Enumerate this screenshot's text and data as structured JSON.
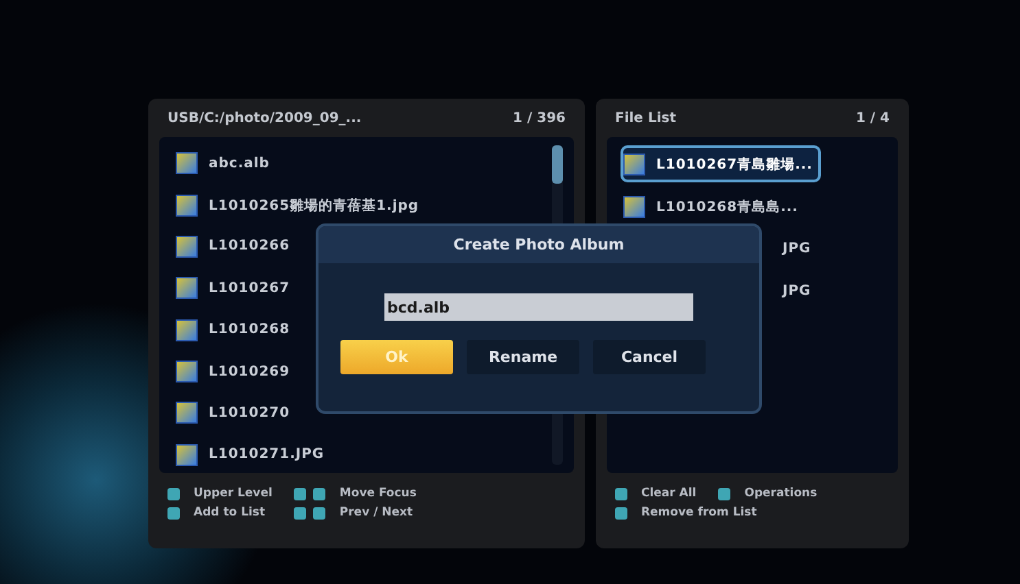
{
  "browser": {
    "path": "USB/C:/photo/2009_09_...",
    "count": "1 / 396",
    "files": [
      {
        "name": "abc.alb"
      },
      {
        "name": "L1010265雛場的青蓓基1.jpg"
      },
      {
        "name": "L1010266"
      },
      {
        "name": "L1010267"
      },
      {
        "name": "L1010268"
      },
      {
        "name": "L1010269"
      },
      {
        "name": "L1010270"
      },
      {
        "name": "L1010271.JPG"
      }
    ],
    "hints": [
      {
        "kind": "single",
        "label": "Upper Level"
      },
      {
        "kind": "pair",
        "label": "Move Focus"
      },
      {
        "kind": "single",
        "label": "Add to List"
      },
      {
        "kind": "pair",
        "label": "Prev / Next"
      }
    ]
  },
  "file_list": {
    "title": "File List",
    "count": "1 / 4",
    "files": [
      {
        "name": "L1010267青島雛場...",
        "selected": true
      },
      {
        "name": "L1010268青島島...",
        "selected": false
      },
      {
        "name": "JPG",
        "selected": false,
        "kind": "tail"
      },
      {
        "name": "JPG",
        "selected": false,
        "kind": "tail"
      }
    ],
    "hints": [
      {
        "kind": "single",
        "label": "Clear All"
      },
      {
        "kind": "single",
        "label": "Operations"
      },
      {
        "kind": "single",
        "label": "Remove from List"
      }
    ]
  },
  "dialog": {
    "title": "Create Photo Album",
    "value": "bcd.alb",
    "buttons": [
      {
        "label": "Ok",
        "selected": true
      },
      {
        "label": "Rename",
        "selected": false
      },
      {
        "label": "Cancel",
        "selected": false
      }
    ]
  }
}
